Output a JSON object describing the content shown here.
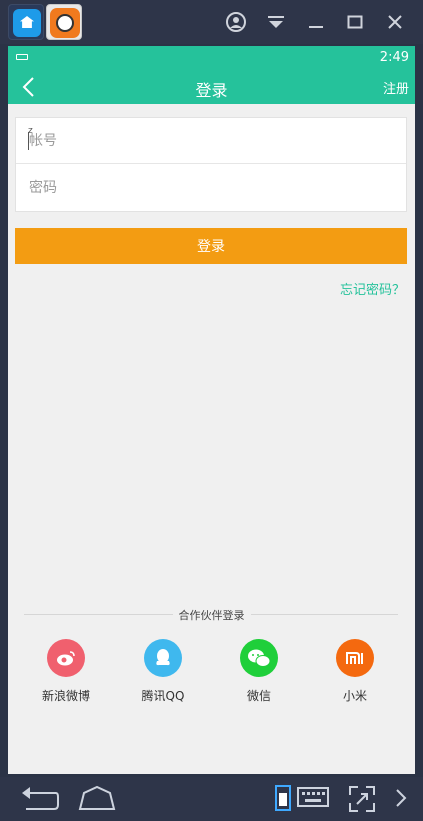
{
  "emulator": {
    "apps": [
      {
        "icon": "home-app-icon"
      },
      {
        "icon": "game-app-icon"
      }
    ],
    "controls": [
      "account-icon",
      "dropdown-icon",
      "minimize-icon",
      "maximize-icon",
      "close-icon"
    ],
    "nav": [
      "back-nav-icon",
      "home-nav-icon",
      "portrait-mode-icon",
      "keyboard-icon",
      "fullscreen-icon",
      "chevron-right-icon"
    ]
  },
  "statusbar": {
    "time": "2:49"
  },
  "appbar": {
    "title": "登录",
    "register_label": "注册"
  },
  "form": {
    "account": {
      "placeholder": "帐号",
      "value": ""
    },
    "password": {
      "placeholder": "密码",
      "value": ""
    }
  },
  "login_button": "登录",
  "forgot_password": "忘记密码？",
  "partners": {
    "title": "合作伙伴登录",
    "items": [
      {
        "label": "新浪微博",
        "icon": "weibo-icon",
        "color": "#f0606e"
      },
      {
        "label": "腾讯QQ",
        "icon": "qq-icon",
        "color": "#3fb8ee"
      },
      {
        "label": "微信",
        "icon": "wechat-icon",
        "color": "#1fcf3a"
      },
      {
        "label": "小米",
        "icon": "xiaomi-icon",
        "color": "#f4690f"
      }
    ]
  },
  "colors": {
    "accent": "#25c29b",
    "login_button": "#f39c12"
  }
}
